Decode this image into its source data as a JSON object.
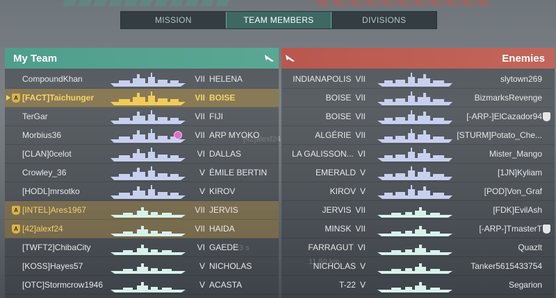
{
  "tabs": [
    {
      "label": "MISSION",
      "active": false
    },
    {
      "label": "TEAM MEMBERS",
      "active": true
    },
    {
      "label": "DIVISIONS",
      "active": false
    }
  ],
  "my_team": {
    "title": "My Team",
    "rows": [
      {
        "player": "CompoundKhan",
        "tier": "VII",
        "ship": "HELENA",
        "class": "cruiser",
        "status": ""
      },
      {
        "player": "[FACT]Taichunger",
        "tier": "VII",
        "ship": "BOISE",
        "class": "cruiser",
        "status": "self",
        "badge": "A"
      },
      {
        "player": "TerGar",
        "tier": "VII",
        "ship": "FIJI",
        "class": "cruiser",
        "status": ""
      },
      {
        "player": "Morbius36",
        "tier": "VII",
        "ship": "ARP MYOKO",
        "class": "cruiser",
        "status": ""
      },
      {
        "player": "[CLAN]0celot",
        "tier": "VI",
        "ship": "DALLAS",
        "class": "cruiser",
        "status": ""
      },
      {
        "player": "Crowley_36",
        "tier": "V",
        "ship": "ÉMILE BERTIN",
        "class": "cruiser",
        "status": ""
      },
      {
        "player": "[HODL]mrsotko",
        "tier": "V",
        "ship": "KIROV",
        "class": "cruiser",
        "status": ""
      },
      {
        "player": "[INTEL]Ares1967",
        "tier": "VII",
        "ship": "JERVIS",
        "class": "destroyer",
        "status": "division",
        "badge": "A"
      },
      {
        "player": "[42]alexf24",
        "tier": "VII",
        "ship": "HAIDA",
        "class": "destroyer",
        "status": "division",
        "badge": "A"
      },
      {
        "player": "[TWFT2]ChibaCity",
        "tier": "VI",
        "ship": "GAEDE",
        "class": "destroyer",
        "status": ""
      },
      {
        "player": "[KOSS]Hayes57",
        "tier": "V",
        "ship": "NICHOLAS",
        "class": "destroyer",
        "status": ""
      },
      {
        "player": "[OTC]Stormcrow1946",
        "tier": "V",
        "ship": "ACASTA",
        "class": "destroyer",
        "status": ""
      }
    ]
  },
  "enemies": {
    "title": "Enemies",
    "rows": [
      {
        "ship": "INDIANAPOLIS",
        "tier": "VII",
        "player": "slytown269",
        "class": "cruiser"
      },
      {
        "ship": "BOISE",
        "tier": "VII",
        "player": "BizmarksRevenge",
        "class": "cruiser"
      },
      {
        "ship": "BOISE",
        "tier": "VII",
        "player": "[-ARP-]ElCazador94",
        "class": "cruiser",
        "badge": true
      },
      {
        "ship": "ALGÉRIE",
        "tier": "VII",
        "player": "[STURM]Potato_Che...",
        "class": "cruiser"
      },
      {
        "ship": "LA GALISSON...",
        "tier": "VI",
        "player": "Mister_Mango",
        "class": "cruiser"
      },
      {
        "ship": "EMERALD",
        "tier": "V",
        "player": "[1JN]Kyliam",
        "class": "cruiser"
      },
      {
        "ship": "KIROV",
        "tier": "V",
        "player": "[POD]Von_Graf",
        "class": "cruiser"
      },
      {
        "ship": "JERVIS",
        "tier": "VII",
        "player": "[FDK]EvilAsh",
        "class": "destroyer"
      },
      {
        "ship": "MINSK",
        "tier": "VII",
        "player": "[-ARP-]TmasterT",
        "class": "destroyer",
        "badge": true
      },
      {
        "ship": "FARRAGUT",
        "tier": "VI",
        "player": "Quazlt",
        "class": "destroyer"
      },
      {
        "ship": "NICHOLAS",
        "tier": "V",
        "player": "Tanker5615433754",
        "class": "destroyer"
      },
      {
        "ship": "T-22",
        "tier": "V",
        "player": "Segarion",
        "class": "destroyer"
      }
    ]
  },
  "background_text": {
    "counter": "3",
    "label": "[42]alexf24",
    "distance": "11.50 km",
    "timer": "23 s"
  },
  "colors": {
    "ally_header": "#4f9e8c",
    "enemy_header": "#b9574d",
    "cruiser_silhouette": "#c8d0f0",
    "destroyer_silhouette": "#d8f2ea",
    "self_silhouette": "#f2cc58",
    "division_row": "#c49c46"
  },
  "icons": {
    "team_header": "aircraft-icon",
    "enemy_header": "aircraft-icon",
    "division_badge": "rank-shield-icon",
    "enemy_badge": "rank-shield-icon"
  }
}
